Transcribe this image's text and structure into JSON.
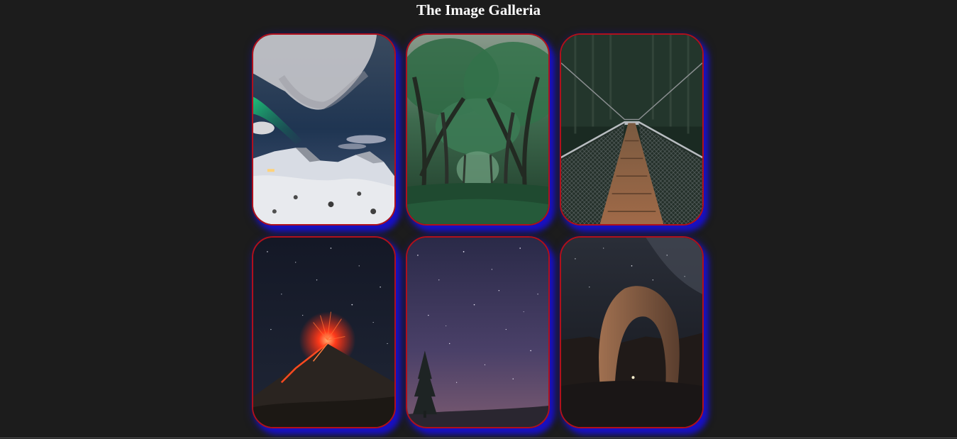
{
  "page": {
    "title": "The Image Galleria",
    "background": "#1c1c1c"
  },
  "theme": {
    "card_border": "#b0101c",
    "card_shadow": "#1810c8"
  },
  "gallery": {
    "items": [
      {
        "scene": "aurora-over-snowy-mountains"
      },
      {
        "scene": "tree-lined-forest-path"
      },
      {
        "scene": "suspension-bridge-in-forest"
      },
      {
        "scene": "erupting-volcano-at-night"
      },
      {
        "scene": "starry-sky-with-pine-tree"
      },
      {
        "scene": "natural-arch-under-milky-way"
      }
    ]
  }
}
